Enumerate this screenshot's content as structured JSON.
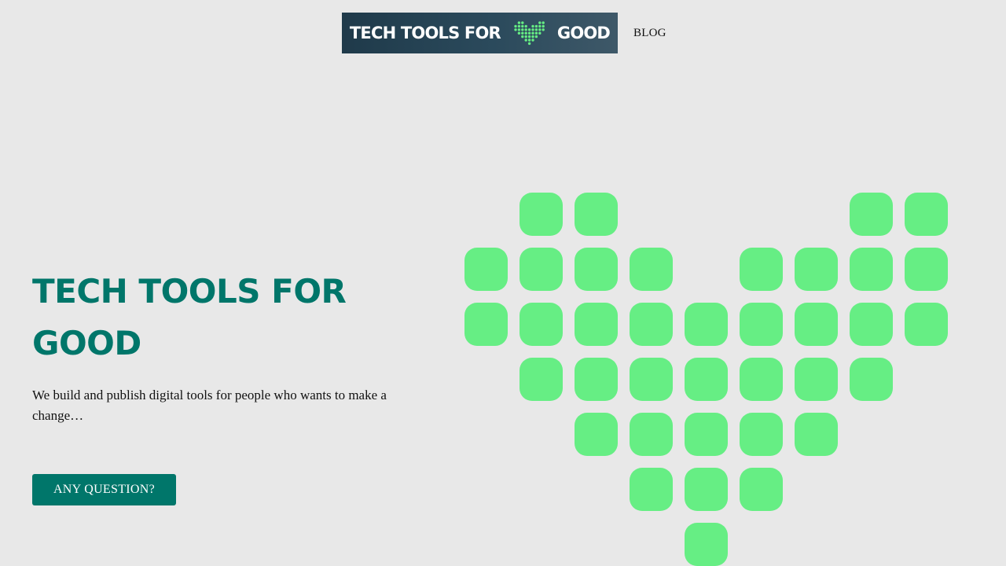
{
  "header": {
    "logo": {
      "text_left": "TECH TOOLS FOR",
      "text_right": "GOOD",
      "icon": "pixel-heart-icon"
    },
    "nav": [
      {
        "label": "BLOG"
      }
    ]
  },
  "hero": {
    "title": "TECH TOOLS FOR GOOD",
    "subtitle": "We build and publish digital tools for people who wants to make a change…",
    "cta_label": "ANY QUESTION?"
  },
  "illustration": {
    "icon": "pixel-heart-icon",
    "rows": [
      "011000011",
      "111101111",
      "111111111",
      "011111110",
      "001111100",
      "000111000",
      "000010000"
    ]
  },
  "colors": {
    "background": "#e8e8e8",
    "accent": "#00766a",
    "heart_green": "#66ee84",
    "logo_bg": "#2b4a5c",
    "text": "#111111"
  }
}
